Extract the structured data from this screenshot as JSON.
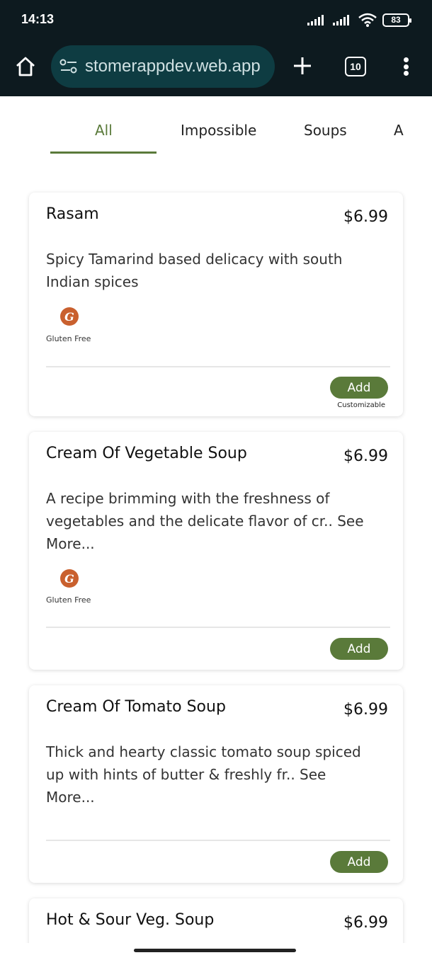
{
  "status": {
    "time": "14:13",
    "battery": "83"
  },
  "browser": {
    "url": "stomerappdev.web.app",
    "tab_count": "10"
  },
  "categories": [
    {
      "label": "All",
      "active": true
    },
    {
      "label": "Impossible",
      "active": false
    },
    {
      "label": "Soups",
      "active": false
    },
    {
      "label": "A",
      "active": false
    }
  ],
  "items": [
    {
      "title": "Rasam",
      "price": "$6.99",
      "desc": "Spicy Tamarind based delicacy with south Indian spices",
      "diet_icon_letter": "G",
      "diet_label": "Gluten Free",
      "add_label": "Add",
      "custom_label": "Customizable"
    },
    {
      "title": "Cream Of Vegetable Soup",
      "price": "$6.99",
      "desc": "A recipe brimming with the freshness of vegetables and the delicate flavor of cr.. See More...",
      "diet_icon_letter": "G",
      "diet_label": "Gluten Free",
      "add_label": "Add"
    },
    {
      "title": "Cream Of Tomato Soup",
      "price": "$6.99",
      "desc": "Thick and hearty classic tomato soup spiced up with hints of butter & freshly fr.. See More...",
      "add_label": "Add"
    },
    {
      "title": "Hot & Sour Veg. Soup",
      "price": "$6.99"
    }
  ],
  "colors": {
    "accent": "#5a7a3a",
    "statusbar": "#0d1a1f",
    "urlbar": "#0e3c42",
    "diet_icon": "#c9602e"
  }
}
